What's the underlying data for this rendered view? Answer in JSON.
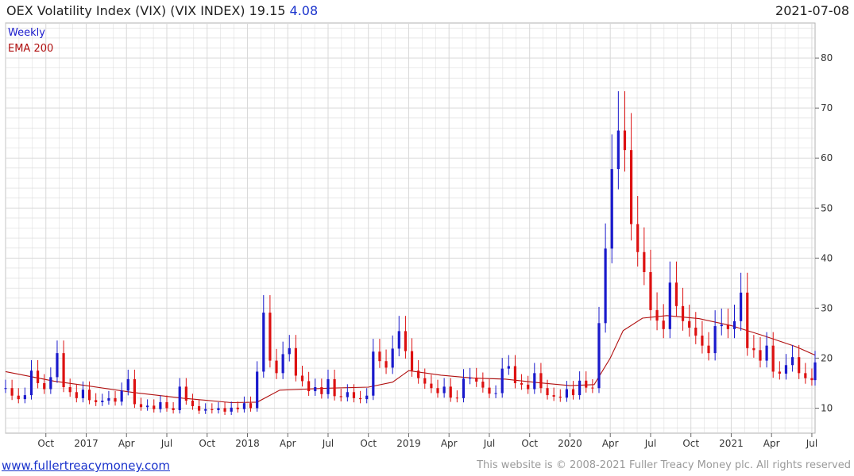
{
  "header": {
    "title": "OEX Volatility Index (VIX) (VIX INDEX)",
    "last": "19.15",
    "change": "4.08",
    "date": "2021-07-08"
  },
  "footer": {
    "link": "www.fullertreacymoney.com",
    "copyright": "This website is © 2008-2021 Fuller Treacy Money plc. All rights reserved"
  },
  "colors": {
    "up": "#1a1acc",
    "down": "#dd1111",
    "ema": "#b01010",
    "grid": "#d9d9d9"
  },
  "chart_data": {
    "type": "candlestick",
    "frequency": "Weekly",
    "x_start": "2016-07-01",
    "x_end": "2021-07-08",
    "ylim": [
      5,
      87
    ],
    "y_ticks": [
      10,
      20,
      30,
      40,
      50,
      60,
      70,
      80
    ],
    "x_ticks": [
      "Oct",
      "2017",
      "Apr",
      "Jul",
      "Oct",
      "2018",
      "Apr",
      "Jul",
      "Oct",
      "2019",
      "Apr",
      "Jul",
      "Oct",
      "2020",
      "Apr",
      "Jul",
      "Oct",
      "2021",
      "Apr",
      "Jul"
    ],
    "grid": true,
    "legend_position": "top-left",
    "series": [
      {
        "name": "Weekly",
        "kind": "close",
        "values": [
          [
            2016.5,
            14.0
          ],
          [
            2016.54,
            12.5
          ],
          [
            2016.58,
            11.8
          ],
          [
            2016.62,
            12.6
          ],
          [
            2016.66,
            17.5
          ],
          [
            2016.7,
            15.0
          ],
          [
            2016.74,
            13.8
          ],
          [
            2016.78,
            16.2
          ],
          [
            2016.82,
            21.0
          ],
          [
            2016.86,
            14.2
          ],
          [
            2016.9,
            13.2
          ],
          [
            2016.94,
            12.0
          ],
          [
            2016.98,
            13.7
          ],
          [
            2017.02,
            11.6
          ],
          [
            2017.06,
            11.2
          ],
          [
            2017.1,
            11.5
          ],
          [
            2017.14,
            12.0
          ],
          [
            2017.18,
            11.3
          ],
          [
            2017.22,
            13.5
          ],
          [
            2017.26,
            15.8
          ],
          [
            2017.3,
            10.8
          ],
          [
            2017.34,
            10.2
          ],
          [
            2017.38,
            10.5
          ],
          [
            2017.42,
            9.8
          ],
          [
            2017.46,
            11.2
          ],
          [
            2017.5,
            10.0
          ],
          [
            2017.54,
            9.6
          ],
          [
            2017.58,
            14.3
          ],
          [
            2017.62,
            11.5
          ],
          [
            2017.66,
            10.4
          ],
          [
            2017.7,
            9.5
          ],
          [
            2017.74,
            9.8
          ],
          [
            2017.78,
            9.6
          ],
          [
            2017.82,
            10.0
          ],
          [
            2017.86,
            9.3
          ],
          [
            2017.9,
            10.1
          ],
          [
            2017.94,
            9.8
          ],
          [
            2017.98,
            11.0
          ],
          [
            2018.02,
            10.0
          ],
          [
            2018.06,
            17.3
          ],
          [
            2018.1,
            29.1
          ],
          [
            2018.14,
            19.5
          ],
          [
            2018.18,
            17.0
          ],
          [
            2018.22,
            20.8
          ],
          [
            2018.26,
            22.0
          ],
          [
            2018.3,
            16.5
          ],
          [
            2018.34,
            15.4
          ],
          [
            2018.38,
            13.4
          ],
          [
            2018.42,
            14.2
          ],
          [
            2018.46,
            12.8
          ],
          [
            2018.5,
            15.8
          ],
          [
            2018.54,
            12.4
          ],
          [
            2018.58,
            12.2
          ],
          [
            2018.62,
            13.2
          ],
          [
            2018.66,
            12.0
          ],
          [
            2018.7,
            11.8
          ],
          [
            2018.74,
            12.5
          ],
          [
            2018.78,
            21.3
          ],
          [
            2018.82,
            19.4
          ],
          [
            2018.86,
            18.1
          ],
          [
            2018.9,
            21.9
          ],
          [
            2018.94,
            25.4
          ],
          [
            2018.98,
            21.4
          ],
          [
            2019.02,
            17.5
          ],
          [
            2019.06,
            16.0
          ],
          [
            2019.1,
            14.9
          ],
          [
            2019.14,
            14.0
          ],
          [
            2019.18,
            13.0
          ],
          [
            2019.22,
            14.3
          ],
          [
            2019.26,
            12.1
          ],
          [
            2019.3,
            12.0
          ],
          [
            2019.34,
            15.9
          ],
          [
            2019.38,
            16.1
          ],
          [
            2019.42,
            15.3
          ],
          [
            2019.46,
            14.1
          ],
          [
            2019.5,
            12.9
          ],
          [
            2019.54,
            13.0
          ],
          [
            2019.58,
            17.9
          ],
          [
            2019.62,
            18.4
          ],
          [
            2019.66,
            15.0
          ],
          [
            2019.7,
            14.7
          ],
          [
            2019.74,
            13.8
          ],
          [
            2019.78,
            17.0
          ],
          [
            2019.82,
            14.0
          ],
          [
            2019.86,
            12.6
          ],
          [
            2019.9,
            12.3
          ],
          [
            2019.94,
            12.1
          ],
          [
            2019.98,
            13.8
          ],
          [
            2020.02,
            12.6
          ],
          [
            2020.06,
            15.5
          ],
          [
            2020.1,
            14.1
          ],
          [
            2020.14,
            14.0
          ],
          [
            2020.18,
            27.0
          ],
          [
            2020.22,
            41.9
          ],
          [
            2020.26,
            57.8
          ],
          [
            2020.3,
            65.5
          ],
          [
            2020.34,
            61.6
          ],
          [
            2020.38,
            46.8
          ],
          [
            2020.42,
            41.2
          ],
          [
            2020.46,
            37.2
          ],
          [
            2020.5,
            29.6
          ],
          [
            2020.54,
            27.5
          ],
          [
            2020.58,
            25.8
          ],
          [
            2020.62,
            35.1
          ],
          [
            2020.66,
            30.4
          ],
          [
            2020.7,
            27.4
          ],
          [
            2020.74,
            26.1
          ],
          [
            2020.78,
            24.5
          ],
          [
            2020.82,
            22.5
          ],
          [
            2020.86,
            21.0
          ],
          [
            2020.9,
            26.4
          ],
          [
            2020.94,
            26.7
          ],
          [
            2020.98,
            25.8
          ],
          [
            2021.02,
            27.4
          ],
          [
            2021.06,
            33.1
          ],
          [
            2021.1,
            22.0
          ],
          [
            2021.14,
            21.6
          ],
          [
            2021.18,
            19.5
          ],
          [
            2021.22,
            22.5
          ],
          [
            2021.26,
            17.3
          ],
          [
            2021.3,
            16.9
          ],
          [
            2021.34,
            18.6
          ],
          [
            2021.38,
            20.2
          ],
          [
            2021.42,
            17.0
          ],
          [
            2021.46,
            16.0
          ],
          [
            2021.5,
            15.6
          ],
          [
            2021.52,
            19.15
          ]
        ]
      },
      {
        "name": "EMA 200",
        "kind": "line",
        "values": [
          [
            2016.5,
            17.3
          ],
          [
            2016.8,
            15.4
          ],
          [
            2017.0,
            14.5
          ],
          [
            2017.3,
            13.1
          ],
          [
            2017.6,
            12.0
          ],
          [
            2017.9,
            11.1
          ],
          [
            2018.06,
            11.2
          ],
          [
            2018.2,
            13.6
          ],
          [
            2018.5,
            14.0
          ],
          [
            2018.75,
            14.2
          ],
          [
            2018.9,
            15.2
          ],
          [
            2019.0,
            17.5
          ],
          [
            2019.2,
            16.6
          ],
          [
            2019.4,
            16.0
          ],
          [
            2019.6,
            15.8
          ],
          [
            2019.8,
            15.1
          ],
          [
            2020.0,
            14.5
          ],
          [
            2020.15,
            14.7
          ],
          [
            2020.25,
            20.0
          ],
          [
            2020.33,
            25.5
          ],
          [
            2020.45,
            28.0
          ],
          [
            2020.6,
            28.5
          ],
          [
            2020.8,
            27.9
          ],
          [
            2021.0,
            26.5
          ],
          [
            2021.2,
            24.5
          ],
          [
            2021.4,
            22.3
          ],
          [
            2021.52,
            20.6
          ]
        ]
      }
    ]
  }
}
